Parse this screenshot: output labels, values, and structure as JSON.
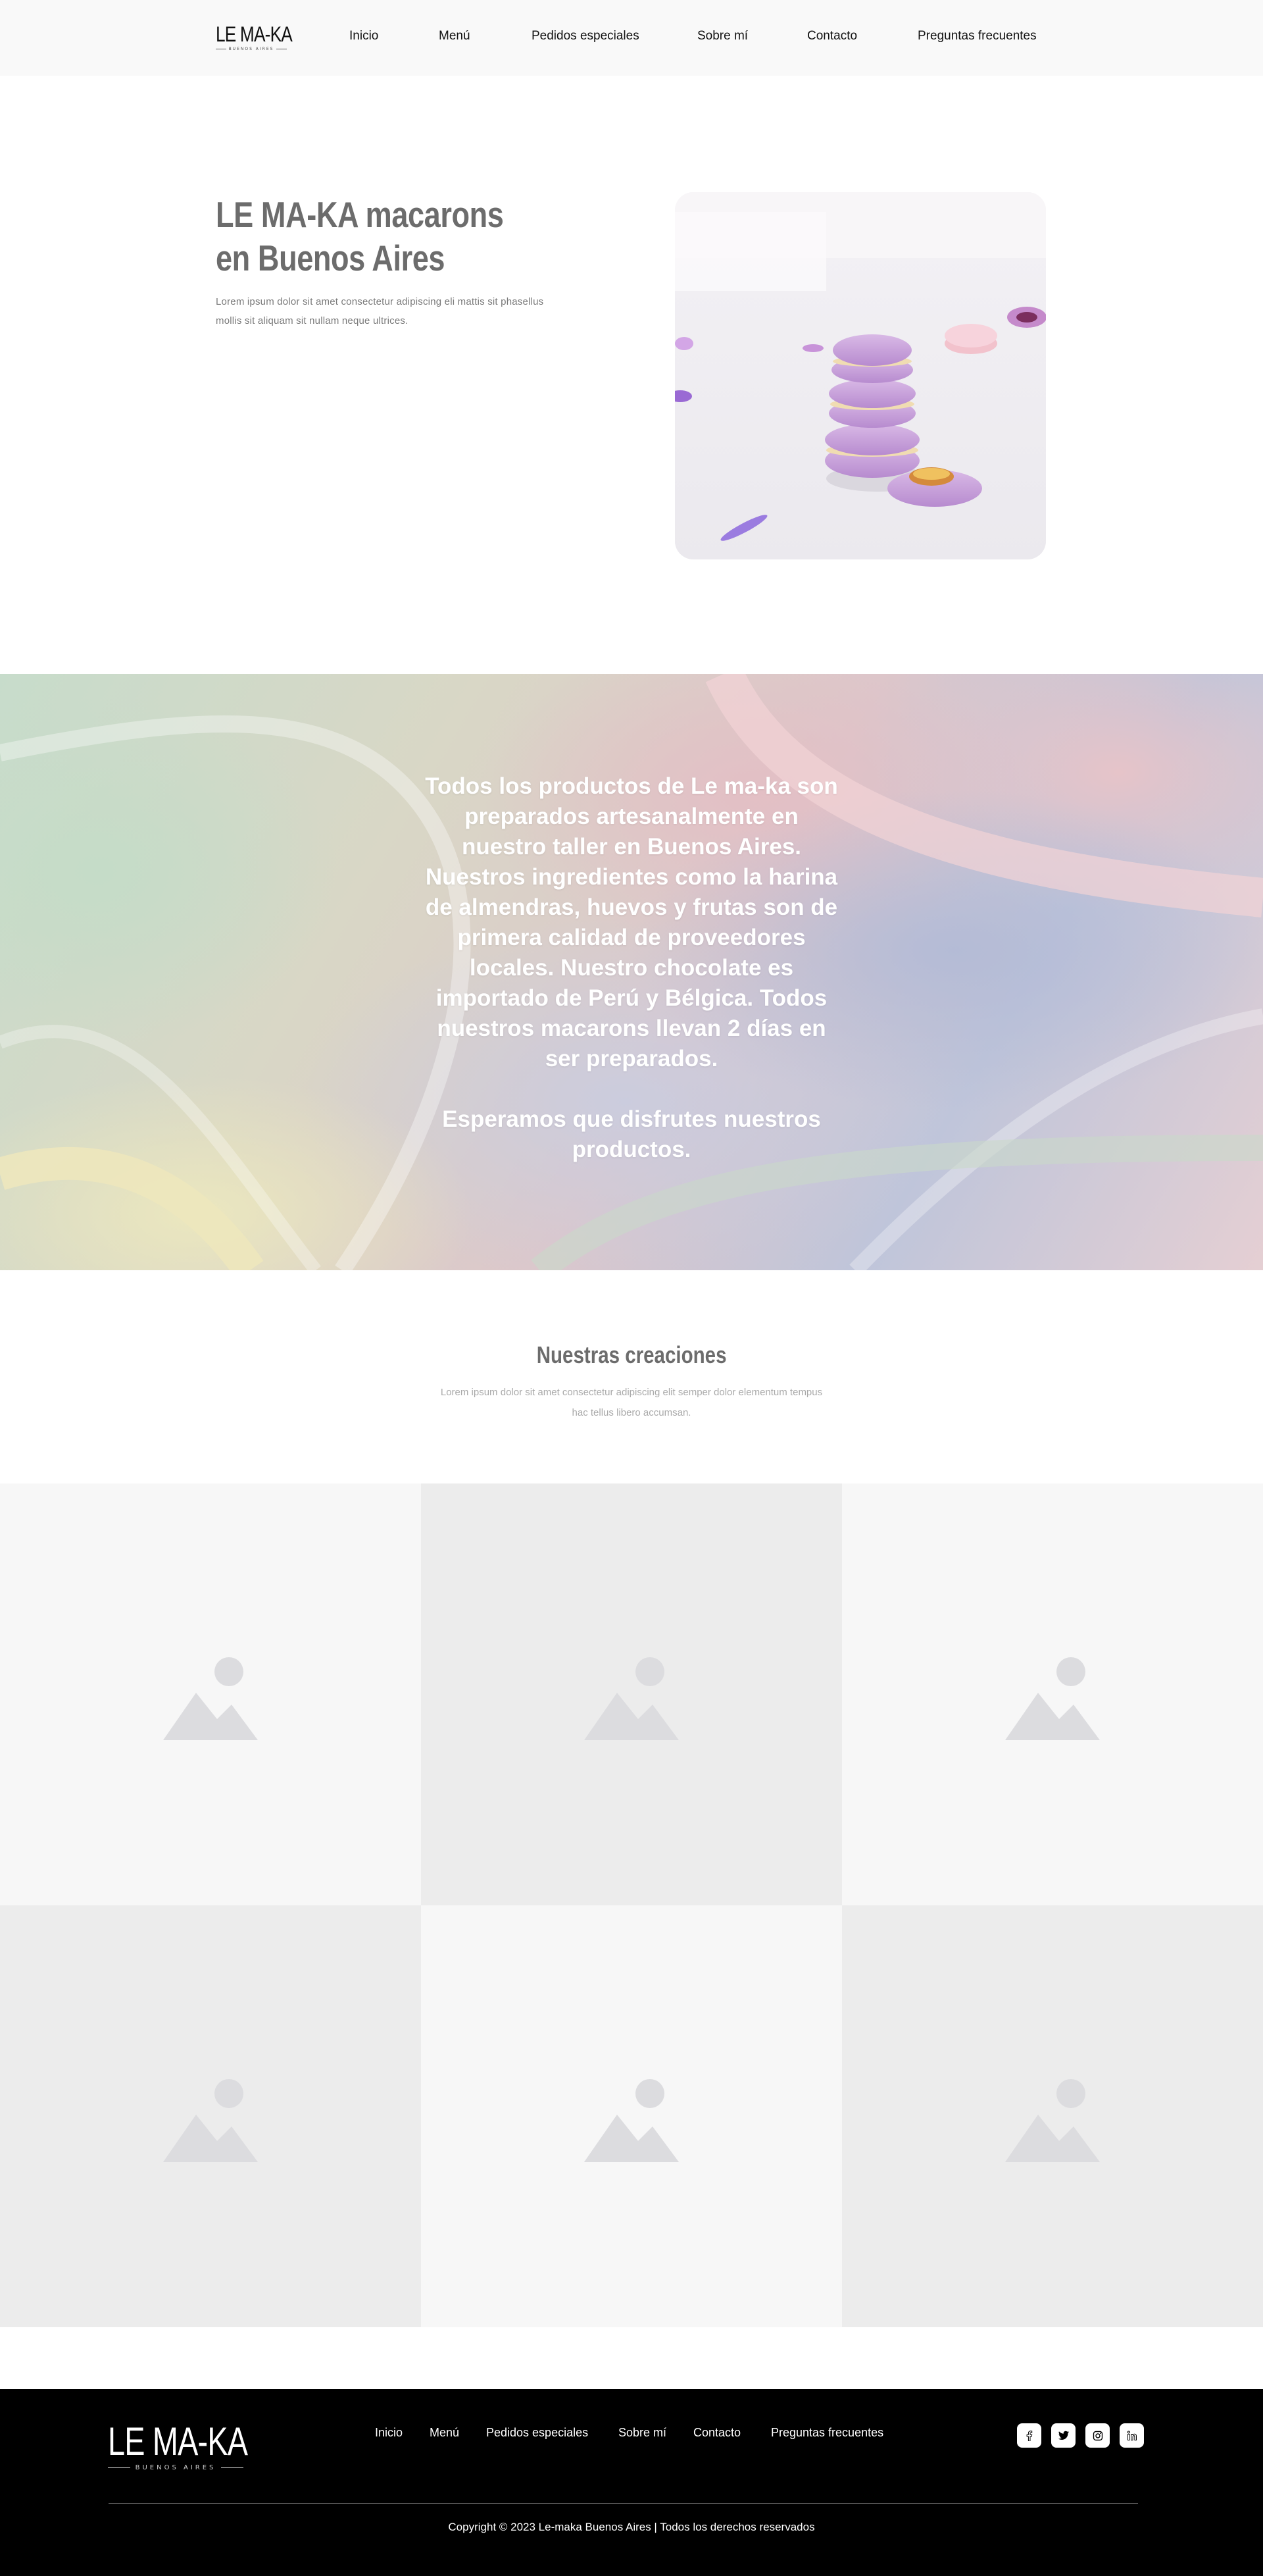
{
  "nav": {
    "logo_main": "LE MA-KA",
    "logo_sub": "BUENOS AIRES",
    "items": [
      {
        "label": "Inicio"
      },
      {
        "label": "Menú"
      },
      {
        "label": "Pedidos especiales"
      },
      {
        "label": "Sobre mí"
      },
      {
        "label": "Contacto"
      },
      {
        "label": "Preguntas frecuentes"
      }
    ]
  },
  "hero": {
    "title": "LE MA-KA macarons en Buenos Aires",
    "text": "Lorem ipsum dolor sit amet consectetur adipiscing eli mattis sit phasellus mollis sit aliquam sit nullam neque ultrices.",
    "image_icon": "macarons-photo"
  },
  "banner": {
    "paragraph1": "Todos los productos de Le ma-ka son preparados artesanalmente en nuestro taller en Buenos Aires. Nuestros ingredientes como la harina de almendras, huevos y frutas son de primera calidad de proveedores locales. Nuestro chocolate es importado de Perú y Bélgica. Todos nuestros macarons llevan 2 días en ser preparados.",
    "paragraph2": "Esperamos que disfrutes nuestros productos."
  },
  "creations": {
    "title": "Nuestras creaciones",
    "text": "Lorem ipsum dolor sit amet consectetur adipiscing elit semper dolor elementum tempus hac tellus libero accumsan.",
    "cells": [
      {
        "bg": "#f7f7f7",
        "icon": "image-placeholder-icon"
      },
      {
        "bg": "#ececec",
        "icon": "image-placeholder-icon"
      },
      {
        "bg": "#f7f7f7",
        "icon": "image-placeholder-icon"
      },
      {
        "bg": "#ececec",
        "icon": "image-placeholder-icon"
      },
      {
        "bg": "#f7f7f7",
        "icon": "image-placeholder-icon"
      },
      {
        "bg": "#ececec",
        "icon": "image-placeholder-icon"
      }
    ]
  },
  "footer": {
    "logo_main": "LE MA-KA",
    "logo_sub": "BUENOS AIRES",
    "menu": [
      {
        "label": "Inicio"
      },
      {
        "label": "Menú"
      },
      {
        "label": "Pedidos especiales"
      },
      {
        "label": "Sobre mí"
      },
      {
        "label": "Contacto"
      },
      {
        "label": "Preguntas frecuentes"
      }
    ],
    "social": [
      {
        "icon": "facebook-icon"
      },
      {
        "icon": "twitter-icon"
      },
      {
        "icon": "instagram-icon"
      },
      {
        "icon": "linkedin-icon"
      }
    ],
    "copyright": "Copyright © 2023 Le-maka Buenos Aires | Todos los derechos reservados"
  },
  "colors": {
    "nav_bg": "#f9f9f9",
    "heading_gray": "#6c6c6c",
    "footer_bg": "#000000",
    "placeholder_icon": "#dcdcdf"
  }
}
